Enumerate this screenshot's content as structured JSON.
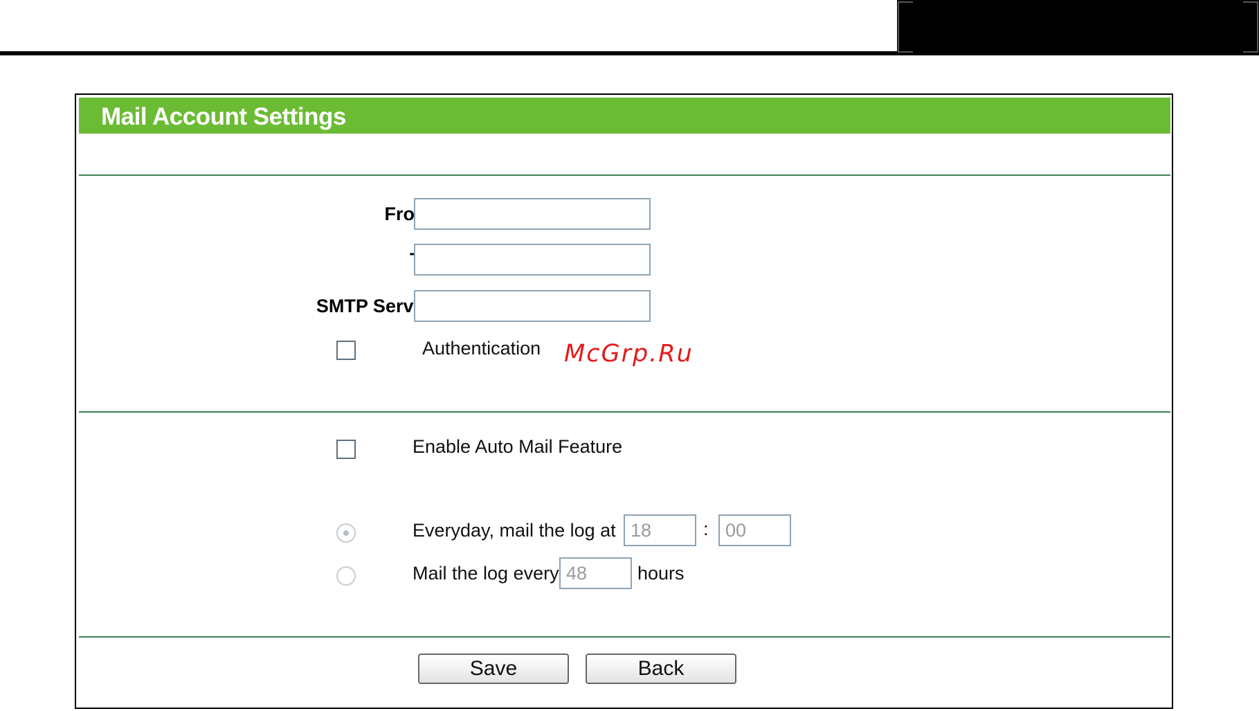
{
  "panel": {
    "title": "Mail Account Settings"
  },
  "account": {
    "from_label": "From:",
    "from_value": "",
    "to_label": "To:",
    "to_value": "",
    "smtp_label": "SMTP Server:",
    "smtp_value": "",
    "auth_label": "Authentication",
    "auth_checked": false
  },
  "automail": {
    "enable_label": "Enable Auto Mail Feature",
    "enable_checked": false,
    "everyday_label": "Everyday, mail the log at",
    "hour_value": "18",
    "colon": ":",
    "minute_value": "00",
    "every_label": "Mail the log every",
    "interval_value": "48",
    "hours_label": "hours",
    "selected_option": "everyday"
  },
  "buttons": {
    "save": "Save",
    "back": "Back"
  },
  "watermark": "McGrp.Ru",
  "colors": {
    "title_bar": "#6cbb34",
    "separator": "#3e7f53",
    "watermark": "#e21b1b"
  }
}
